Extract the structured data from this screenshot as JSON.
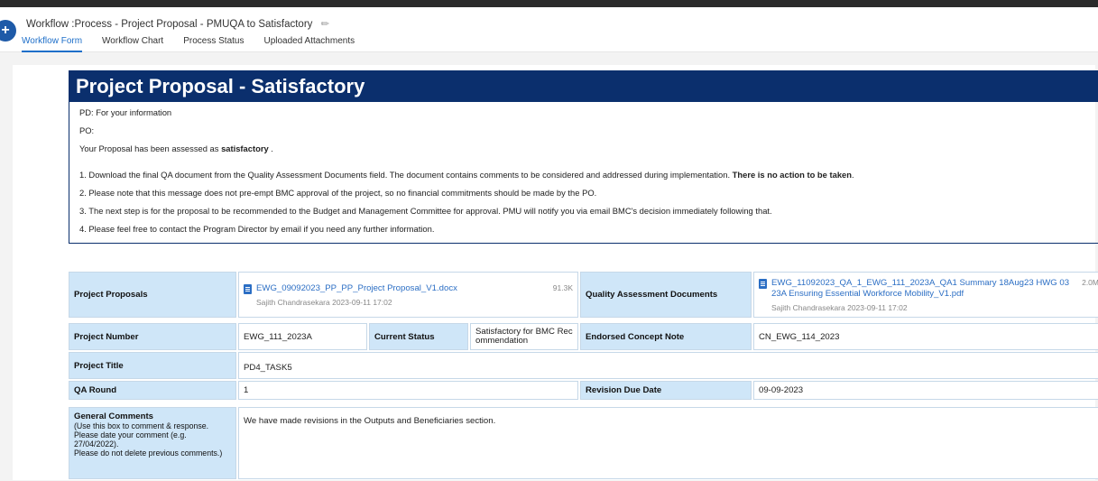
{
  "header": {
    "logo_glyph": "+",
    "title": "Workflow :Process - Project Proposal - PMUQA to Satisfactory",
    "edit_icon": "pencil-icon",
    "tabs": [
      {
        "label": "Workflow Form",
        "active": true
      },
      {
        "label": "Workflow Chart",
        "active": false
      },
      {
        "label": "Process Status",
        "active": false
      },
      {
        "label": "Uploaded Attachments",
        "active": false
      }
    ]
  },
  "banner": {
    "title": "Project Proposal - Satisfactory",
    "line_pd": "PD: For your information",
    "line_po": "PO:",
    "assess_prefix": "Your Proposal has been assessed as ",
    "assess_bold": "satisfactory",
    "assess_suffix": " .",
    "item1_text": "1. Download the final QA document from the Quality Assessment Documents field. The document contains comments to be considered and addressed during implementation. ",
    "item1_bold": "There is no action to be taken",
    "item1_end": ".",
    "item2": "2. Please note that this message does not pre-empt BMC approval of the project, so no financial commitments should be made by the PO.",
    "item3": "3. The next step is for the proposal to be recommended to the Budget and Management Committee for approval. PMU will notify you via email BMC's decision immediately following that.",
    "item4": "4. Please feel free to contact the Program Director by email if you need any further information."
  },
  "files": {
    "proposals_label": "Project Proposals",
    "proposal_file": "EWG_09092023_PP_PP_Project Proposal_V1.docx",
    "proposal_size": "91.3K",
    "proposal_meta": "Sajith Chandrasekara  2023-09-11 17:02",
    "qa_label": "Quality Assessment Documents",
    "qa_file": "EWG_11092023_QA_1_EWG_111_2023A_QA1 Summary 18Aug23 HWG 03 23A Ensuring Essential Workforce Mobility_V1.pdf",
    "qa_size": "2.0M",
    "qa_meta": "Sajith Chandrasekara  2023-09-11 17:02"
  },
  "details": {
    "project_number_label": "Project Number",
    "project_number": "EWG_111_2023A",
    "current_status_label": "Current Status",
    "current_status": "Satisfactory for BMC Rec ommendation",
    "concept_note_label": "Endorsed Concept Note",
    "concept_note": "CN_EWG_114_2023",
    "project_title_label": "Project Title",
    "project_title": "PD4_TASK5",
    "qa_round_label": "QA Round",
    "qa_round": "1",
    "revision_due_label": "Revision Due Date",
    "revision_due": "09-09-2023"
  },
  "comments": {
    "label": "General Comments",
    "hint1": "(Use this box to comment & response.",
    "hint2": "Please date your comment (e.g. 27/04/2022).",
    "hint3": "Please do not delete previous comments.)",
    "text": "We have made revisions in the Outputs and Beneficiaries section."
  }
}
